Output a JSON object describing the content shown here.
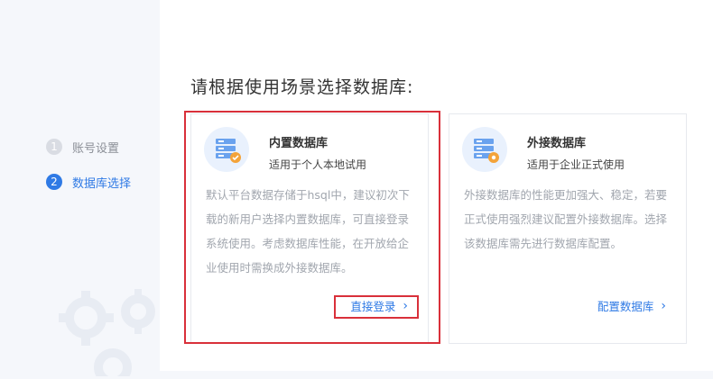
{
  "sidebar": {
    "steps": [
      {
        "num": "1",
        "label": "账号设置"
      },
      {
        "num": "2",
        "label": "数据库选择"
      }
    ]
  },
  "main": {
    "title": "请根据使用场景选择数据库:"
  },
  "cards": [
    {
      "title": "内置数据库",
      "subtitle": "适用于个人本地试用",
      "desc": "默认平台数据存储于hsql中，建议初次下载的新用户选择内置数据库，可直接登录系统使用。考虑数据库性能，在开放给企业使用时需换成外接数据库。",
      "action": "直接登录",
      "icon": "database-check-icon"
    },
    {
      "title": "外接数据库",
      "subtitle": "适用于企业正式使用",
      "desc": "外接数据库的性能更加强大、稳定，若要正式使用强烈建议配置外接数据库。选择该数据库需先进行数据库配置。",
      "action": "配置数据库",
      "icon": "database-gear-icon"
    }
  ],
  "colors": {
    "accent": "#2f7ae5",
    "highlight": "#d9303a",
    "sidebar_bg": "#f5f7fb"
  }
}
